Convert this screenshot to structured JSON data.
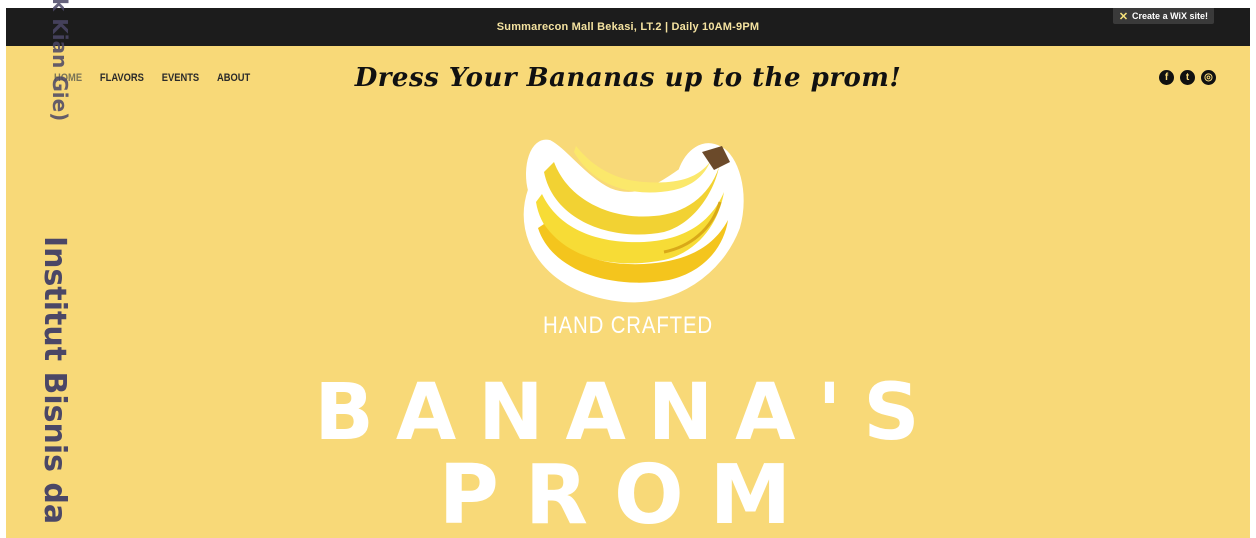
{
  "topbar": {
    "info": "Summarecon Mall Bekasi, LT.2  |  Daily 10AM-9PM",
    "wix_badge": "Create a WiX site!"
  },
  "nav": {
    "items": [
      "HOME",
      "FLAVORS",
      "EVENTS",
      "ABOUT"
    ]
  },
  "header": {
    "tagline": "Dress Your Bananas up to the prom!"
  },
  "social": {
    "icons": [
      "facebook-icon",
      "twitter-icon",
      "instagram-icon"
    ]
  },
  "hero": {
    "subtitle": "HAND CRAFTED",
    "title_line1": "BANANA'S",
    "title_line2": "PROM"
  },
  "watermark": {
    "line_a": "k Kian Gie)",
    "line_b": "Institut Bisnis da"
  },
  "colors": {
    "background": "#f8d978",
    "topbar": "#1c1c1c",
    "title": "#ffffff",
    "watermark": "#4b4766"
  }
}
